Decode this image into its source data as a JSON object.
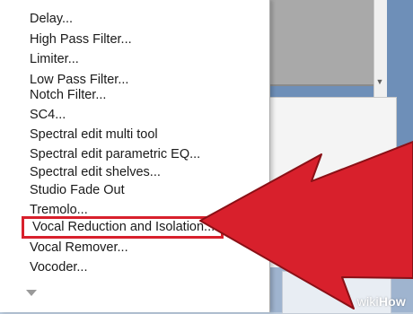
{
  "menu": {
    "items": [
      {
        "label": "Delay..."
      },
      {
        "label": "High Pass Filter..."
      },
      {
        "label": "Limiter..."
      },
      {
        "label": "Low Pass Filter..."
      },
      {
        "label": "Notch Filter..."
      },
      {
        "label": "SC4..."
      },
      {
        "label": "Spectral edit multi tool"
      },
      {
        "label": "Spectral edit parametric EQ..."
      },
      {
        "label": "Spectral edit shelves..."
      },
      {
        "label": "Studio Fade Out"
      },
      {
        "label": "Tremolo..."
      },
      {
        "label": "Vocal Reduction and Isolation..."
      },
      {
        "label": "Vocal Remover..."
      },
      {
        "label": "Vocoder..."
      }
    ],
    "highlighted_item": "Vocal Reduction and Isolation...",
    "scroll_arrow_icon": "chevron-down-icon"
  },
  "annotation": {
    "arrow_icon": "red-arrow-icon",
    "arrow_color": "#d8202c",
    "highlight_color": "#d8202c"
  },
  "watermark": {
    "prefix": "wiki",
    "suffix": "How"
  }
}
